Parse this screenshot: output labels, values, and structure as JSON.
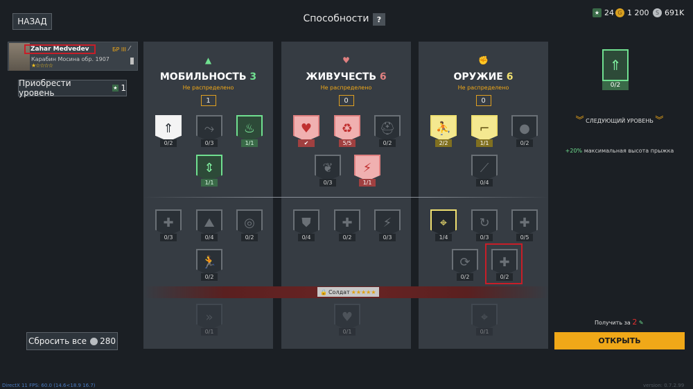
{
  "header": {
    "back_label": "НАЗАД",
    "title": "Способности",
    "help_label": "?",
    "currencies": [
      {
        "icon": "rank-token-icon",
        "value": "24"
      },
      {
        "icon": "gold-coin-icon",
        "value": "1 200"
      },
      {
        "icon": "silver-coin-icon",
        "value": "691K"
      }
    ]
  },
  "character": {
    "name": "Zahar Medvedev",
    "br": "БР III",
    "weapon": "Карабин Мосина обр. 1907",
    "stars": "★☆☆☆☆"
  },
  "buy_level": {
    "label": "Приобрести уровень",
    "cost": "1"
  },
  "reset": {
    "label": "Сбросить все",
    "cost": "280"
  },
  "columns": [
    {
      "icon": "mobility-icon",
      "title": "МОБИЛЬНОСТЬ",
      "value": "3",
      "subtitle": "Не распределено",
      "points": "1",
      "skills": [
        "0/2",
        "0/3",
        "1/1",
        "1/1",
        "0/3",
        "0/4",
        "0/2",
        "0/2",
        "0/1"
      ]
    },
    {
      "icon": "heart-pulse-icon",
      "title": "ЖИВУЧЕСТЬ",
      "value": "6",
      "subtitle": "Не распределено",
      "points": "0",
      "skills": [
        "✔",
        "5/5",
        "0/2",
        "0/3",
        "1/1",
        "0/4",
        "0/2",
        "0/3",
        "0/1"
      ]
    },
    {
      "icon": "fist-icon",
      "title": "ОРУЖИЕ",
      "value": "6",
      "subtitle": "Не распределено",
      "points": "0",
      "skills": [
        "2/2",
        "1/1",
        "0/2",
        "0/4",
        "1/4",
        "0/3",
        "0/5",
        "0/2",
        "0/2",
        "0/1"
      ]
    }
  ],
  "rank_gate": {
    "label": "Солдат",
    "stars": "★★★★★"
  },
  "next": {
    "count": "0/2",
    "label": "СЛЕДУЮЩИЙ УРОВЕНЬ",
    "desc_value": "+20%",
    "desc_text": "максимальная высота прыжка",
    "get_for": "Получить за",
    "get_cost": "2",
    "open_label": "ОТКРЫТЬ"
  },
  "footer": {
    "fps": "DirectX 11 FPS: 60.0 (14.6<18.9 16.7)",
    "version": "version: 0.7.2.99"
  },
  "colors": {
    "accent": "#f0a818",
    "green": "#70e090",
    "red": "#e08080",
    "yellow": "#f0e070"
  }
}
